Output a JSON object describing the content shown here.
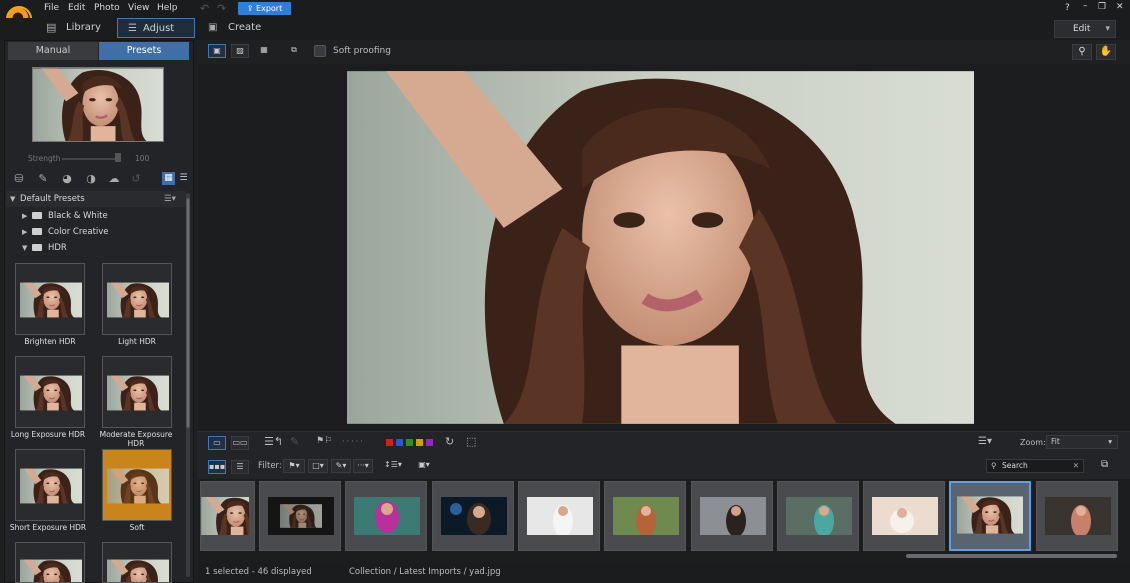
{
  "menu": {
    "items": [
      "File",
      "Edit",
      "Photo",
      "View",
      "Help"
    ],
    "export_label": "Export",
    "help_icon": "?"
  },
  "modes": {
    "library": "Library",
    "adjust": "Adjust",
    "create": "Create",
    "edit_dropdown": "Edit"
  },
  "left_panel": {
    "tabs": [
      "Manual",
      "Presets"
    ],
    "active_tab": "Presets",
    "strength_label": "Strength",
    "strength_value": "100",
    "tree": {
      "root": "Default Presets",
      "folders": [
        "Black & White",
        "Color Creative",
        "HDR"
      ]
    },
    "presets": [
      "Brighten HDR",
      "Light HDR",
      "Long Exposure HDR",
      "Moderate Exposure HDR",
      "Short Exposure HDR",
      "Soft"
    ]
  },
  "viewer_toolbar": {
    "soft_proofing_label": "Soft proofing"
  },
  "filmstrip_toolbar": {
    "zoom_label": "Zoom:",
    "zoom_value": "Fit",
    "filter_label": "Filter:",
    "search_placeholder": "Search",
    "color_labels": [
      "#d02020",
      "#2f57c8",
      "#2e8b2e",
      "#c9a400",
      "#8a2bc8"
    ]
  },
  "status": {
    "selection": "1 selected - 46 displayed",
    "path": "Collection / Latest Imports / yad.jpg"
  }
}
